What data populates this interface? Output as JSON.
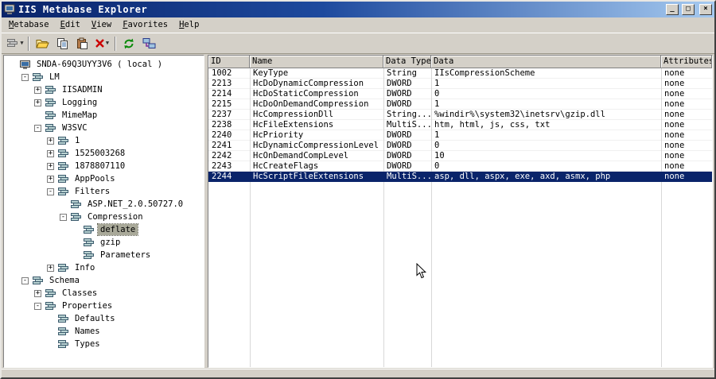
{
  "window": {
    "title": "IIS Metabase Explorer",
    "buttons": {
      "minimize": "_",
      "maximize": "□",
      "close": "×"
    }
  },
  "menu": {
    "items": [
      "Metabase",
      "Edit",
      "View",
      "Favorites",
      "Help"
    ]
  },
  "toolbar": {
    "icons": [
      "new-key-dropdown",
      "open-folder",
      "copy",
      "paste",
      "delete-dropdown",
      "refresh",
      "connect-computer"
    ]
  },
  "tree": {
    "items": [
      {
        "label": "SNDA-69Q3UYY3V6 ( local )",
        "indent": 0,
        "box": null,
        "icon": "server",
        "selected": false
      },
      {
        "label": "LM",
        "indent": 1,
        "box": "minus",
        "icon": "key",
        "selected": false
      },
      {
        "label": "IISADMIN",
        "indent": 2,
        "box": "plus",
        "icon": "key",
        "selected": false
      },
      {
        "label": "Logging",
        "indent": 2,
        "box": "plus",
        "icon": "key",
        "selected": false
      },
      {
        "label": "MimeMap",
        "indent": 2,
        "box": null,
        "icon": "key",
        "selected": false
      },
      {
        "label": "W3SVC",
        "indent": 2,
        "box": "minus",
        "icon": "key",
        "selected": false
      },
      {
        "label": "1",
        "indent": 3,
        "box": "plus",
        "icon": "key",
        "selected": false
      },
      {
        "label": "1525003268",
        "indent": 3,
        "box": "plus",
        "icon": "key",
        "selected": false
      },
      {
        "label": "1878807110",
        "indent": 3,
        "box": "plus",
        "icon": "key",
        "selected": false
      },
      {
        "label": "AppPools",
        "indent": 3,
        "box": "plus",
        "icon": "key",
        "selected": false
      },
      {
        "label": "Filters",
        "indent": 3,
        "box": "minus",
        "icon": "key",
        "selected": false
      },
      {
        "label": "ASP.NET_2.0.50727.0",
        "indent": 4,
        "box": null,
        "icon": "key",
        "selected": false
      },
      {
        "label": "Compression",
        "indent": 4,
        "box": "minus",
        "icon": "key",
        "selected": false
      },
      {
        "label": "deflate",
        "indent": 5,
        "box": null,
        "icon": "key",
        "selected": true
      },
      {
        "label": "gzip",
        "indent": 5,
        "box": null,
        "icon": "key",
        "selected": false
      },
      {
        "label": "Parameters",
        "indent": 5,
        "box": null,
        "icon": "key",
        "selected": false
      },
      {
        "label": "Info",
        "indent": 3,
        "box": "plus",
        "icon": "key",
        "selected": false
      },
      {
        "label": "Schema",
        "indent": 1,
        "box": "minus",
        "icon": "key",
        "selected": false
      },
      {
        "label": "Classes",
        "indent": 2,
        "box": "plus",
        "icon": "key",
        "selected": false
      },
      {
        "label": "Properties",
        "indent": 2,
        "box": "minus",
        "icon": "key",
        "selected": false
      },
      {
        "label": "Defaults",
        "indent": 3,
        "box": null,
        "icon": "key",
        "selected": false
      },
      {
        "label": "Names",
        "indent": 3,
        "box": null,
        "icon": "key",
        "selected": false
      },
      {
        "label": "Types",
        "indent": 3,
        "box": null,
        "icon": "key",
        "selected": false
      }
    ]
  },
  "table": {
    "columns": [
      "ID",
      "Name",
      "Data Type",
      "Data",
      "Attributes"
    ],
    "rows": [
      {
        "cells": [
          "1002",
          "KeyType",
          "String",
          "IIsCompressionScheme",
          "none"
        ],
        "selected": false
      },
      {
        "cells": [
          "2213",
          "HcDoDynamicCompression",
          "DWORD",
          "1",
          "none"
        ],
        "selected": false
      },
      {
        "cells": [
          "2214",
          "HcDoStaticCompression",
          "DWORD",
          "0",
          "none"
        ],
        "selected": false
      },
      {
        "cells": [
          "2215",
          "HcDoOnDemandCompression",
          "DWORD",
          "1",
          "none"
        ],
        "selected": false
      },
      {
        "cells": [
          "2237",
          "HcCompressionDll",
          "String...",
          "%windir%\\system32\\inetsrv\\gzip.dll",
          "none"
        ],
        "selected": false
      },
      {
        "cells": [
          "2238",
          "HcFileExtensions",
          "MultiS...",
          "htm, html, js, css, txt",
          "none"
        ],
        "selected": false
      },
      {
        "cells": [
          "2240",
          "HcPriority",
          "DWORD",
          "1",
          "none"
        ],
        "selected": false
      },
      {
        "cells": [
          "2241",
          "HcDynamicCompressionLevel",
          "DWORD",
          "0",
          "none"
        ],
        "selected": false
      },
      {
        "cells": [
          "2242",
          "HcOnDemandCompLevel",
          "DWORD",
          "10",
          "none"
        ],
        "selected": false
      },
      {
        "cells": [
          "2243",
          "HcCreateFlags",
          "DWORD",
          "0",
          "none"
        ],
        "selected": false
      },
      {
        "cells": [
          "2244",
          "HcScriptFileExtensions",
          "MultiS...",
          "asp, dll, aspx, exe, axd, asmx, php",
          "none"
        ],
        "selected": true
      }
    ]
  },
  "statusbar": {
    "text": ""
  }
}
